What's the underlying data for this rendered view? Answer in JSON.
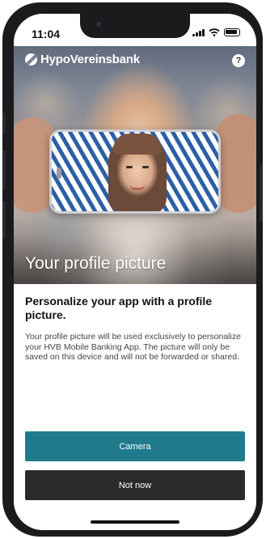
{
  "status_bar": {
    "time": "11:04"
  },
  "header": {
    "brand": "HypoVereinsbank",
    "help_label": "?"
  },
  "hero": {
    "title": "Your profile picture"
  },
  "content": {
    "subtitle": "Personalize your app with a profile picture.",
    "body": "Your profile picture will be used exclusively to personalize your HVB Mobile Banking App. The picture will only be saved on this device and will not be forwarded or shared."
  },
  "actions": {
    "camera_label": "Camera",
    "not_now_label": "Not now"
  },
  "icons": {
    "brand": "hvb-logo-icon",
    "help": "help-icon",
    "signal": "signal-icon",
    "wifi": "wifi-icon",
    "battery": "battery-icon"
  },
  "colors": {
    "primary_button": "#1f7a8c",
    "secondary_button": "#2a2a2c",
    "text_dark": "#111111",
    "text_body": "#444444"
  }
}
